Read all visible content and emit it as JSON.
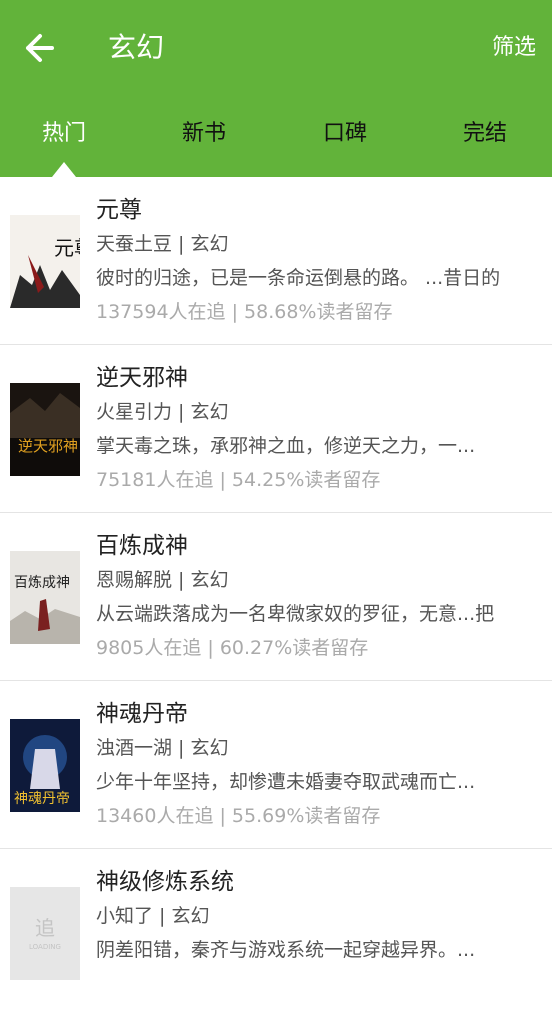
{
  "header": {
    "title": "玄幻",
    "filter_label": "筛选",
    "bg_color": "#62b33a"
  },
  "tabs": [
    {
      "label": "热门",
      "active": true
    },
    {
      "label": "新书",
      "active": false
    },
    {
      "label": "口碑",
      "active": false
    },
    {
      "label": "完结",
      "active": false
    }
  ],
  "books": [
    {
      "title": "元尊",
      "author_line": "天蚕土豆 | 玄幻",
      "description": "彼时的归途，已是一条命运倒悬的路。 ...昔日的",
      "stats": "137594人在追 |  58.68%读者留存",
      "cover_text": "元尊"
    },
    {
      "title": "逆天邪神",
      "author_line": "火星引力 | 玄幻",
      "description": "掌天毒之珠，承邪神之血，修逆天之力，一...",
      "stats": "75181人在追 |  54.25%读者留存",
      "cover_text": "逆天邪神"
    },
    {
      "title": "百炼成神",
      "author_line": "恩赐解脱 | 玄幻",
      "description": "从云端跌落成为一名卑微家奴的罗征，无意...把",
      "stats": "9805人在追 |  60.27%读者留存",
      "cover_text": "百炼成神"
    },
    {
      "title": "神魂丹帝",
      "author_line": "浊酒一湖 | 玄幻",
      "description": "少年十年坚持，却惨遭未婚妻夺取武魂而亡...",
      "stats": "13460人在追 |  55.69%读者留存",
      "cover_text": "神魂丹帝"
    },
    {
      "title": "神级修炼系统",
      "author_line": "小知了 | 玄幻",
      "description": "阴差阳错，秦齐与游戏系统一起穿越异界。...",
      "stats": "",
      "cover_text": "追",
      "cover_subtext": "LOADING"
    }
  ]
}
